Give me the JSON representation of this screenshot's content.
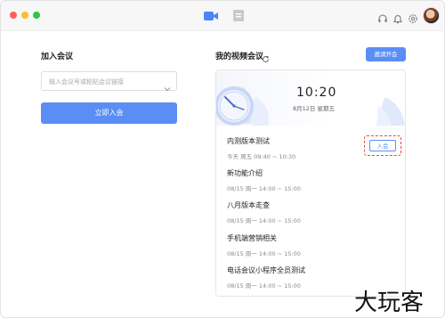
{
  "titlebar": {
    "icons": [
      "video-tab-icon",
      "document-tab-icon",
      "headset-icon",
      "bell-icon",
      "gear-icon",
      "avatar"
    ],
    "accent_color": "#5b8ef5"
  },
  "join": {
    "title": "加入会议",
    "input_placeholder": "输入会议号或粘贴会议链接",
    "button_label": "立即入会"
  },
  "meetings": {
    "title": "我的视频会议",
    "invite_label": "邀请开会",
    "clock_time": "10:20",
    "clock_date": "8月12日 星期五",
    "items": [
      {
        "name": "内测版本测试",
        "time": "今天  周五  09:40 ~ 10:30",
        "action": "入会"
      },
      {
        "name": "新功能介绍",
        "time": "08/15  周一  14:00 ~ 15:00"
      },
      {
        "name": "八月版本走查",
        "time": "08/15  周一  14:00 ~ 15:00"
      },
      {
        "name": "手机端营销相关",
        "time": "08/15  周一  14:00 ~ 15:00"
      },
      {
        "name": "电话会议小程序全员测试",
        "time": "08/15  周一  14:00 ~ 15:00"
      }
    ]
  },
  "watermark": "大玩客"
}
